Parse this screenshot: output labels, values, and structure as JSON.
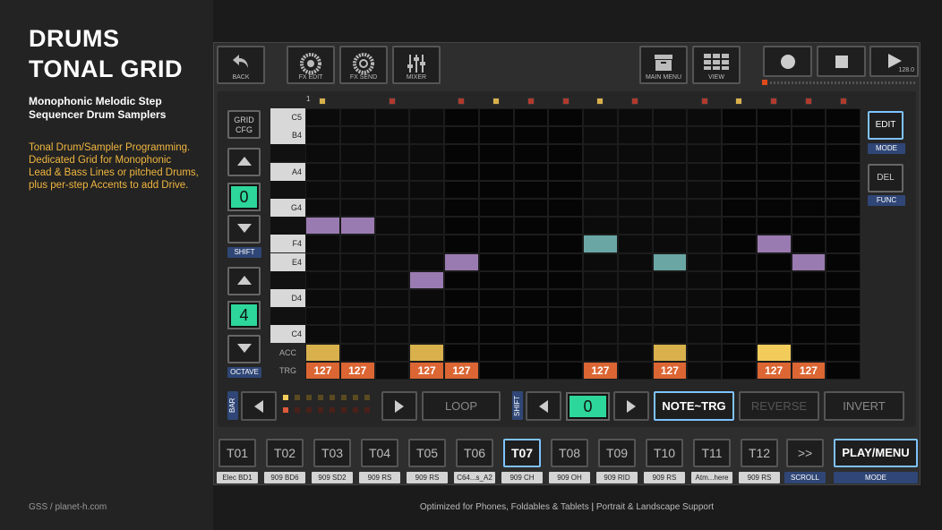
{
  "promo": {
    "title_line1": "DRUMS",
    "title_line2": "TONAL GRID",
    "subtitle_line1": "Monophonic Melodic Step",
    "subtitle_line2": "Sequencer Drum Samplers",
    "desc_lines": [
      "Tonal Drum/Sampler Programming.",
      "Dedicated Grid for Monophonic",
      "Lead & Bass Lines or pitched Drums,",
      "plus per-step Accents to add Drive."
    ],
    "credit": "GSS / planet-h.com",
    "footer_a": "Optimized for Phones, Foldables & Tablets",
    "footer_sep": "|",
    "footer_b": "Portrait & Landscape Support"
  },
  "toolbar": {
    "back": "BACK",
    "fx_edit": "FX EDIT",
    "fx_send": "FX SEND",
    "mixer": "MIXER",
    "main_menu": "MAIN MENU",
    "view": "VIEW",
    "bpm": "128.0"
  },
  "left_controls": {
    "grid_cfg_1": "GRID",
    "grid_cfg_2": "CFG",
    "shift_value": "0",
    "shift_label": "SHIFT",
    "octave_value": "4",
    "octave_label": "OCTAVE"
  },
  "right_controls": {
    "edit": "EDIT",
    "mode": "MODE",
    "del": "DEL",
    "func": "FUNC"
  },
  "grid": {
    "step_start": "1",
    "rows": [
      "C5",
      "B4",
      "",
      "A4",
      "",
      "G4",
      "",
      "F4",
      "E4",
      "",
      "D4",
      "",
      "C4"
    ],
    "row_types": [
      "w",
      "w",
      "b",
      "w",
      "b",
      "w",
      "b",
      "w",
      "w",
      "b",
      "w",
      "b",
      "w"
    ],
    "acc_label": "ACC",
    "trg_label": "TRG",
    "notes": [
      {
        "step": 1,
        "row": 6,
        "color": "purple"
      },
      {
        "step": 2,
        "row": 6,
        "color": "purple"
      },
      {
        "step": 4,
        "row": 9,
        "color": "purple"
      },
      {
        "step": 5,
        "row": 8,
        "color": "purple"
      },
      {
        "step": 9,
        "row": 7,
        "color": "teal"
      },
      {
        "step": 11,
        "row": 8,
        "color": "teal"
      },
      {
        "step": 14,
        "row": 7,
        "color": "purple"
      },
      {
        "step": 15,
        "row": 8,
        "color": "purple"
      }
    ],
    "accents": [
      1,
      4,
      11,
      14
    ],
    "accent_hi": [
      14
    ],
    "triggers": [
      {
        "step": 1,
        "v": "127"
      },
      {
        "step": 2,
        "v": "127"
      },
      {
        "step": 4,
        "v": "127"
      },
      {
        "step": 5,
        "v": "127"
      },
      {
        "step": 9,
        "v": "127"
      },
      {
        "step": 11,
        "v": "127"
      },
      {
        "step": 14,
        "v": "127"
      },
      {
        "step": 15,
        "v": "127"
      }
    ],
    "step_markers": [
      {
        "step": 1,
        "kind": "yellow"
      },
      {
        "step": 3,
        "kind": "red"
      },
      {
        "step": 5,
        "kind": "red"
      },
      {
        "step": 6,
        "kind": "yellow"
      },
      {
        "step": 7,
        "kind": "red"
      },
      {
        "step": 8,
        "kind": "red"
      },
      {
        "step": 9,
        "kind": "yellow"
      },
      {
        "step": 10,
        "kind": "red"
      },
      {
        "step": 12,
        "kind": "red"
      },
      {
        "step": 13,
        "kind": "yellow"
      },
      {
        "step": 14,
        "kind": "red"
      },
      {
        "step": 15,
        "kind": "red"
      },
      {
        "step": 16,
        "kind": "red"
      }
    ]
  },
  "bottom_bar": {
    "bar_label": "BAR",
    "loop": "LOOP",
    "shift_label": "SHIFT",
    "shift_value": "0",
    "note_trg": "NOTE~TRG",
    "reverse": "REVERSE",
    "invert": "INVERT"
  },
  "tracks": [
    {
      "id": "T01",
      "name": "Elec BD1"
    },
    {
      "id": "T02",
      "name": "909 BD6"
    },
    {
      "id": "T03",
      "name": "909 SD2"
    },
    {
      "id": "T04",
      "name": "909 RS"
    },
    {
      "id": "T05",
      "name": "909 RS"
    },
    {
      "id": "T06",
      "name": "C64...s_A2"
    },
    {
      "id": "T07",
      "name": "909 CH",
      "selected": true
    },
    {
      "id": "T08",
      "name": "909 OH"
    },
    {
      "id": "T09",
      "name": "909 RID"
    },
    {
      "id": "T10",
      "name": "909 RS"
    },
    {
      "id": "T11",
      "name": "Atm...here"
    },
    {
      "id": "T12",
      "name": "909 RS"
    }
  ],
  "scroll": {
    "label": ">>",
    "tag": "SCROLL"
  },
  "play_menu": {
    "label": "PLAY/MENU",
    "tag": "MODE"
  },
  "colors": {
    "accent": "#2dd69a",
    "highlight": "#7ec3ff",
    "note_purple": "#9a7bb1",
    "note_teal": "#6aa7a4",
    "acc": "#d8b04c",
    "trg": "#db6633"
  }
}
